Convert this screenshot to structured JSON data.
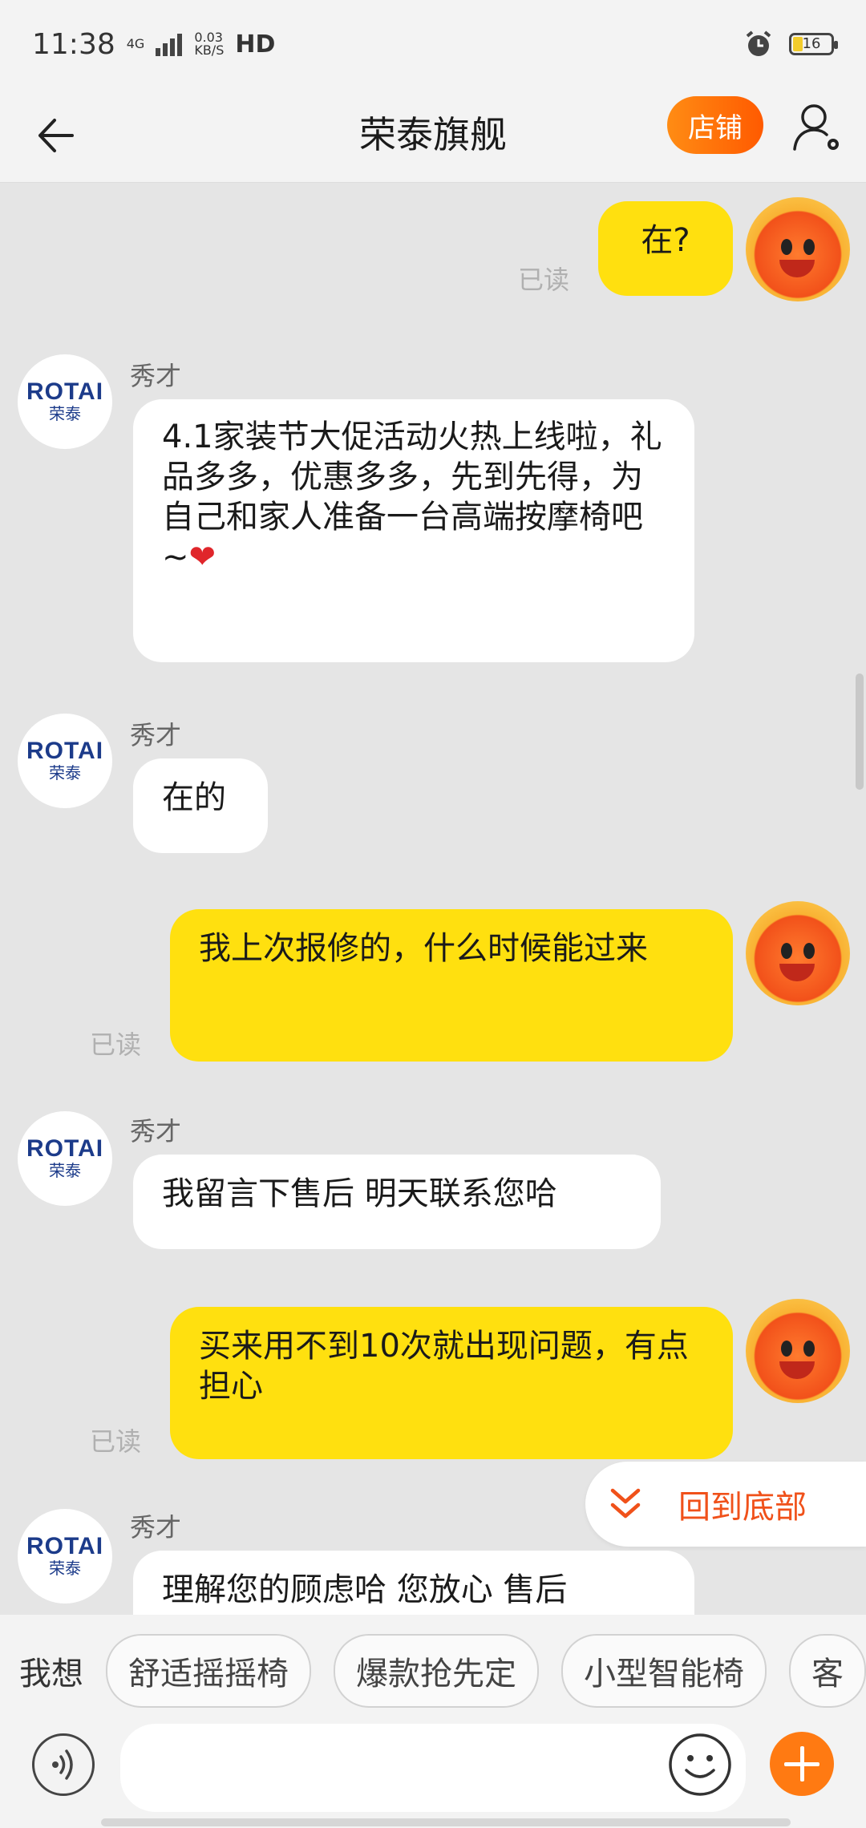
{
  "status_bar": {
    "time": "11:38",
    "network": "4G",
    "speed_value": "0.03",
    "speed_unit": "KB/S",
    "hd": "HD",
    "battery": "16"
  },
  "header": {
    "title": "荣泰旗舰",
    "shop_button": "店铺"
  },
  "messages": [
    {
      "from": "me",
      "text": "在?",
      "read": "已读"
    },
    {
      "from": "shop",
      "sender": "秀才",
      "text": "4.1家装节大促活动火热上线啦，礼品多多，优惠多多，先到先得，为自己和家人准备一台高端按摩椅吧~",
      "emoji": "❤"
    },
    {
      "from": "shop",
      "sender": "秀才",
      "text": "在的"
    },
    {
      "from": "me",
      "text": "我上次报修的，什么时候能过来",
      "read": "已读"
    },
    {
      "from": "shop",
      "sender": "秀才",
      "text": "我留言下售后 明天联系您哈"
    },
    {
      "from": "me",
      "text": "买来用不到10次就出现问题，有点担心",
      "read": "已读"
    },
    {
      "from": "shop",
      "sender": "秀才",
      "text": "理解您的顾虑哈 您放心 售后"
    }
  ],
  "shop_avatar": {
    "brand": "ROTAI",
    "brand_cn": "荣泰"
  },
  "back_to_bottom": "回到底部",
  "suggestions": {
    "label": "我想",
    "chips": [
      "舒适摇摇椅",
      "爆款抢先定",
      "小型智能椅",
      "客"
    ]
  },
  "input": {
    "placeholder": ""
  },
  "colors": {
    "accent": "#ff7a12",
    "my_bubble": "#ffe00f",
    "background": "#e5e5e5"
  }
}
